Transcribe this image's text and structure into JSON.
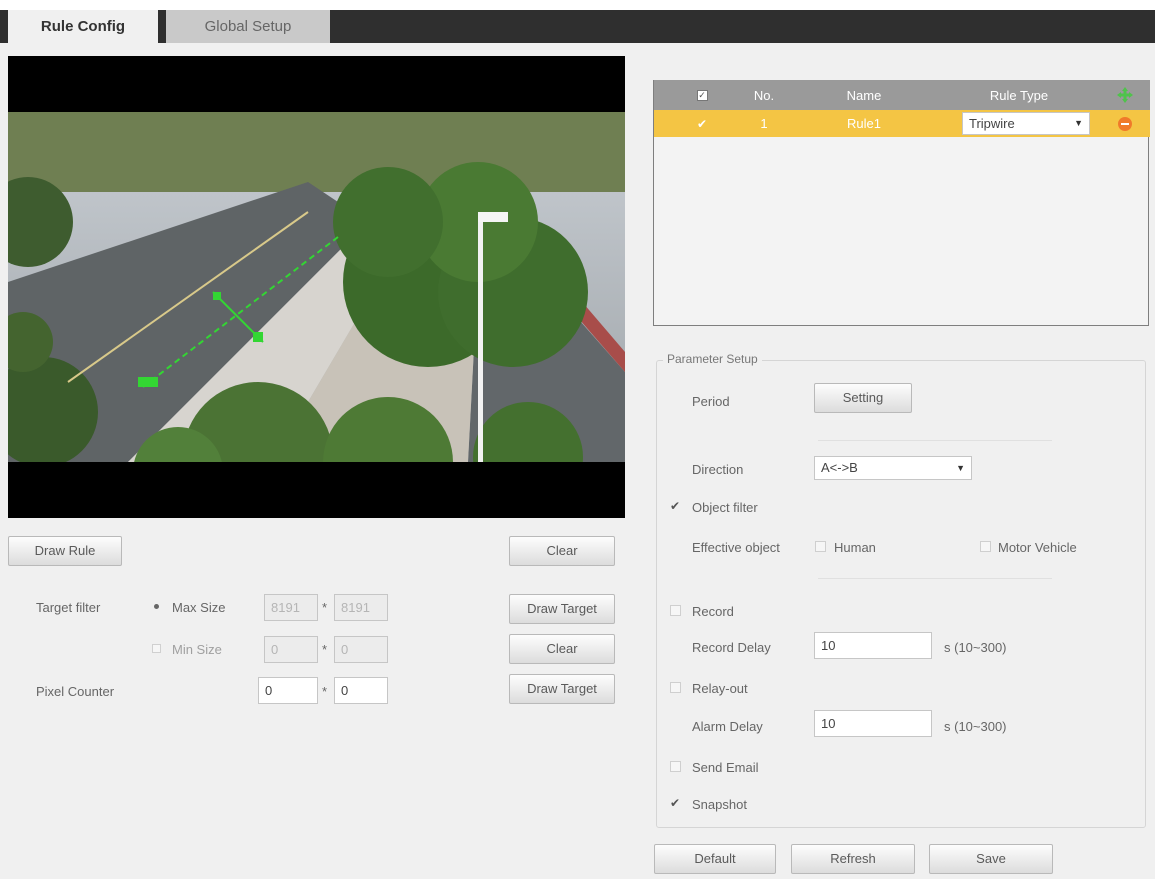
{
  "tabs": {
    "active": "Rule Config",
    "inactive": "Global Setup"
  },
  "video_controls": {
    "draw_rule": "Draw Rule",
    "clear": "Clear",
    "target_filter_label": "Target filter",
    "max_size_label": "Max Size",
    "max_w": "8191",
    "max_h": "8191",
    "min_size_label": "Min Size",
    "min_w": "0",
    "min_h": "0",
    "times": "*",
    "draw_target_1": "Draw Target",
    "clear_2": "Clear",
    "pixel_counter_label": "Pixel Counter",
    "pixel_w": "0",
    "pixel_h": "0",
    "draw_target_2": "Draw Target"
  },
  "rule_table": {
    "headers": {
      "no": "No.",
      "name": "Name",
      "rule_type": "Rule Type"
    },
    "rows": [
      {
        "no": "1",
        "name": "Rule1",
        "rule_type": "Tripwire",
        "checked": true
      }
    ]
  },
  "params": {
    "legend": "Parameter Setup",
    "period_label": "Period",
    "setting_button": "Setting",
    "direction_label": "Direction",
    "direction_value": "A<->B",
    "object_filter_label": "Object filter",
    "object_filter_checked": true,
    "effective_object_label": "Effective object",
    "human_label": "Human",
    "motor_vehicle_label": "Motor Vehicle",
    "record_label": "Record",
    "record_delay_label": "Record Delay",
    "record_delay_value": "10",
    "record_delay_unit": "s (10~300)",
    "relay_out_label": "Relay-out",
    "alarm_delay_label": "Alarm Delay",
    "alarm_delay_value": "10",
    "alarm_delay_unit": "s (10~300)",
    "send_email_label": "Send Email",
    "snapshot_label": "Snapshot",
    "snapshot_checked": true
  },
  "footer": {
    "default": "Default",
    "refresh": "Refresh",
    "save": "Save"
  },
  "colors": {
    "selected_row": "#f4c544",
    "table_header": "#9a9a9a",
    "tab_strip": "#2f2f2f",
    "tripwire": "#33d633"
  },
  "icons": {
    "add": "add-rule-icon",
    "delete": "delete-rule-icon"
  }
}
